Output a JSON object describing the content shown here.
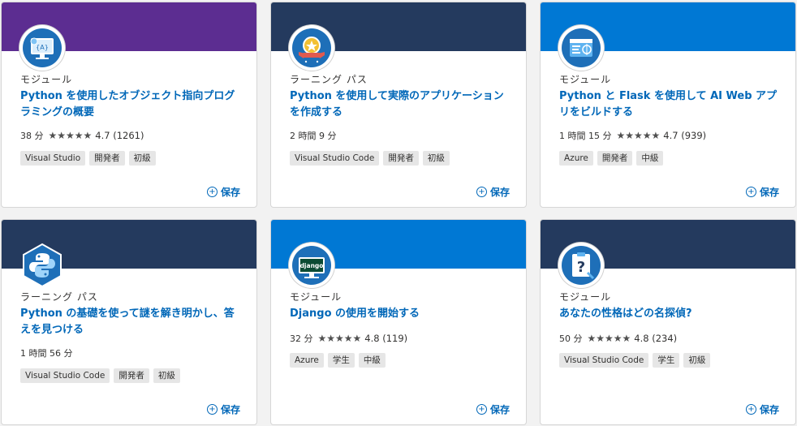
{
  "cards": [
    {
      "banner_color": "#5c2d91",
      "icon": "python-oop-icon",
      "type": "モジュール",
      "title": "Python を使用したオブジェクト指向プログラミングの概要",
      "duration": "38 分",
      "stars": "★★★★★",
      "rating": "4.7 (1261)",
      "tags": [
        "Visual Studio",
        "開発者",
        "初級"
      ],
      "save_label": "保存"
    },
    {
      "banner_color": "#243a5e",
      "icon": "trophy-badge-icon",
      "type": "ラーニング パス",
      "title": "Python を使用して実際のアプリケーションを作成する",
      "duration": "2 時間 9 分",
      "stars": "",
      "rating": "",
      "tags": [
        "Visual Studio Code",
        "開発者",
        "初級"
      ],
      "save_label": "保存"
    },
    {
      "banner_color": "#0078d4",
      "icon": "flask-web-icon",
      "type": "モジュール",
      "title": "Python と Flask を使用して AI Web アプリをビルドする",
      "duration": "1 時間 15 分",
      "stars": "★★★★★",
      "rating": "4.7 (939)",
      "tags": [
        "Azure",
        "開発者",
        "中級"
      ],
      "save_label": "保存"
    },
    {
      "banner_color": "#243a5e",
      "icon": "python-logo-icon",
      "type": "ラーニング パス",
      "title": "Python の基礎を使って謎を解き明かし、答えを見つける",
      "duration": "1 時間 56 分",
      "stars": "",
      "rating": "",
      "tags": [
        "Visual Studio Code",
        "開発者",
        "初級"
      ],
      "save_label": "保存"
    },
    {
      "banner_color": "#0078d4",
      "icon": "django-icon",
      "type": "モジュール",
      "title": "Django の使用を開始する",
      "duration": "32 分",
      "stars": "★★★★★",
      "rating": "4.8 (119)",
      "tags": [
        "Azure",
        "学生",
        "中級"
      ],
      "save_label": "保存"
    },
    {
      "banner_color": "#243a5e",
      "icon": "clipboard-question-icon",
      "type": "モジュール",
      "title": "あなたの性格はどの名探偵?",
      "duration": "50 分",
      "stars": "★★★★★",
      "rating": "4.8 (234)",
      "tags": [
        "Visual Studio Code",
        "学生",
        "初級"
      ],
      "save_label": "保存"
    }
  ]
}
